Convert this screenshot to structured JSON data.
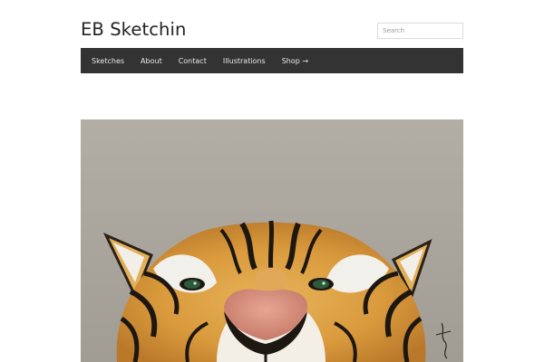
{
  "site": {
    "title": "EB Sketchin"
  },
  "search": {
    "placeholder": "Search"
  },
  "nav": {
    "items": [
      {
        "label": "Sketches"
      },
      {
        "label": "About"
      },
      {
        "label": "Contact"
      },
      {
        "label": "Illustrations"
      },
      {
        "label": "Shop →"
      }
    ]
  },
  "hero": {
    "subject": "tiger-illustration",
    "signature": "signature"
  },
  "colors": {
    "nav_bg": "#333333",
    "nav_text": "#e8e8e8",
    "title": "#222222",
    "hero_bg": "#aaa59d"
  }
}
